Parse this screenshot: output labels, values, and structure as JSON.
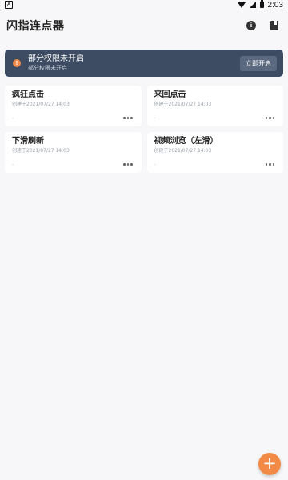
{
  "statusbar": {
    "app_glyph": "A",
    "time": "2:03",
    "icons": [
      "wifi-icon",
      "signal-icon",
      "battery-icon"
    ]
  },
  "appbar": {
    "title": "闪指连点器",
    "icons": [
      "info-icon",
      "book-icon"
    ]
  },
  "banner": {
    "title": "部分权限未开启",
    "subtitle": "部分权限未开启",
    "button": "立即开启",
    "icon": "warning-icon",
    "bg": "#3d4c63"
  },
  "cards": [
    {
      "title": "疯狂点击",
      "date": "创建于2021/07/27 14:03",
      "tag": "-"
    },
    {
      "title": "来回点击",
      "date": "创建于2021/07/27 14:03",
      "tag": "-"
    },
    {
      "title": "下滑刷新",
      "date": "创建于2021/07/27 14:03",
      "tag": "-"
    },
    {
      "title": "视频浏览（左滑）",
      "date": "创建于2021/07/27 14:03",
      "tag": "-"
    }
  ],
  "fab": {
    "label": "+",
    "icon": "plus-icon",
    "color": "#f28a45"
  }
}
